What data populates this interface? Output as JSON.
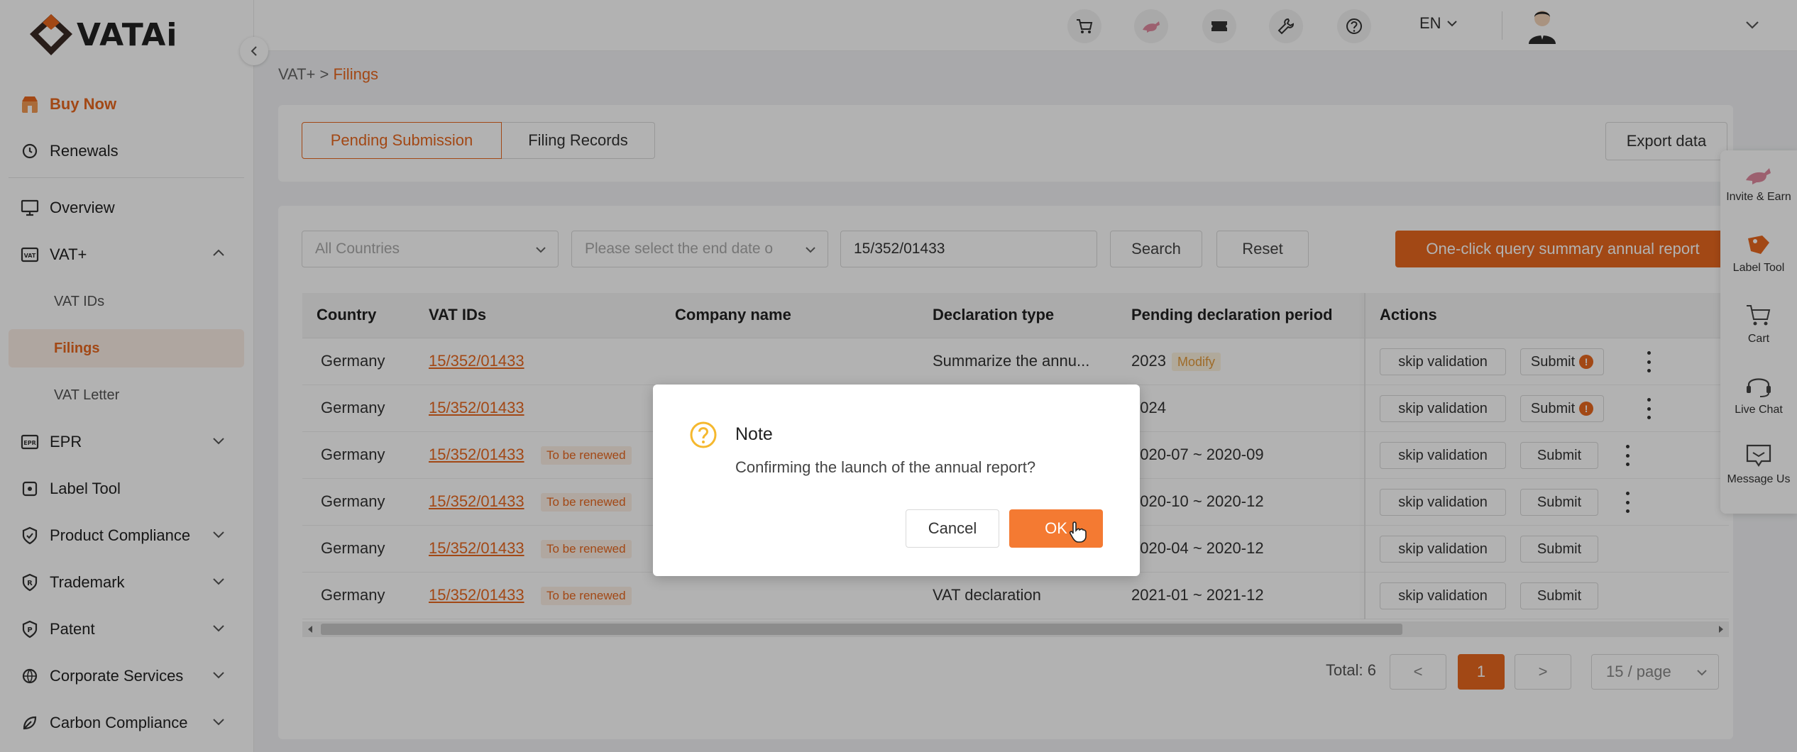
{
  "brand": {
    "name": "VATAi",
    "accent": "#e8671f"
  },
  "sidebar": {
    "buy_now": "Buy Now",
    "renewals": "Renewals",
    "overview": "Overview",
    "vat_plus": "VAT+",
    "vat_ids": "VAT IDs",
    "filings": "Filings",
    "vat_letter": "VAT Letter",
    "epr": "EPR",
    "label_tool": "Label Tool",
    "product_compliance": "Product Compliance",
    "trademark": "Trademark",
    "patent": "Patent",
    "corporate_services": "Corporate Services",
    "carbon_compliance": "Carbon Compliance"
  },
  "header": {
    "icons": [
      "cart-icon",
      "dinosaur-icon",
      "ticket-icon",
      "tools-icon",
      "help-icon"
    ],
    "language": "EN"
  },
  "breadcrumb": {
    "root": "VAT+",
    "sep": ">",
    "current": "Filings"
  },
  "tabs": {
    "pending": "Pending Submission",
    "records": "Filing Records"
  },
  "export_label": "Export data",
  "filters": {
    "country_placeholder": "All Countries",
    "date_placeholder": "Please select the end date o",
    "vat_value": "15/352/01433",
    "search": "Search",
    "reset": "Reset",
    "summary_btn": "One-click query summary annual report"
  },
  "table": {
    "columns": [
      "Country",
      "VAT IDs",
      "Company name",
      "Declaration type",
      "Pending declaration period",
      "Actions"
    ],
    "rows": [
      {
        "country": "Germany",
        "vat": "15/352/01433",
        "tag": "",
        "type": "Summarize the annu...",
        "period": "2023",
        "modify": "Modify",
        "skip": "skip validation",
        "submit": "Submit",
        "info": "!"
      },
      {
        "country": "Germany",
        "vat": "15/352/01433",
        "tag": "",
        "type": "",
        "period": "2024",
        "modify": "",
        "skip": "skip validation",
        "submit": "Submit",
        "info": "!"
      },
      {
        "country": "Germany",
        "vat": "15/352/01433",
        "tag": "To be renewed",
        "type": "",
        "period": "2020-07 ~ 2020-09",
        "modify": "",
        "skip": "skip validation",
        "submit": "Submit",
        "info": ""
      },
      {
        "country": "Germany",
        "vat": "15/352/01433",
        "tag": "To be renewed",
        "type": "",
        "period": "2020-10 ~ 2020-12",
        "modify": "",
        "skip": "skip validation",
        "submit": "Submit",
        "info": ""
      },
      {
        "country": "Germany",
        "vat": "15/352/01433",
        "tag": "To be renewed",
        "type": "",
        "period": "2020-04 ~ 2020-12",
        "modify": "",
        "skip": "skip validation",
        "submit": "Submit",
        "info": ""
      },
      {
        "country": "Germany",
        "vat": "15/352/01433",
        "tag": "To be renewed",
        "type": "VAT declaration",
        "period": "2021-01 ~ 2021-12",
        "modify": "",
        "skip": "skip validation",
        "submit": "Submit",
        "info": ""
      }
    ]
  },
  "pagination": {
    "total": "Total: 6",
    "prev": "<",
    "page": "1",
    "next": ">",
    "page_size": "15 / page"
  },
  "float_panel": {
    "invite": "Invite & Earn",
    "label_tool": "Label Tool",
    "cart": "Cart",
    "live_chat": "Live Chat",
    "message": "Message Us"
  },
  "modal": {
    "title": "Note",
    "message": "Confirming the launch of the annual report?",
    "cancel": "Cancel",
    "ok": "OK"
  }
}
